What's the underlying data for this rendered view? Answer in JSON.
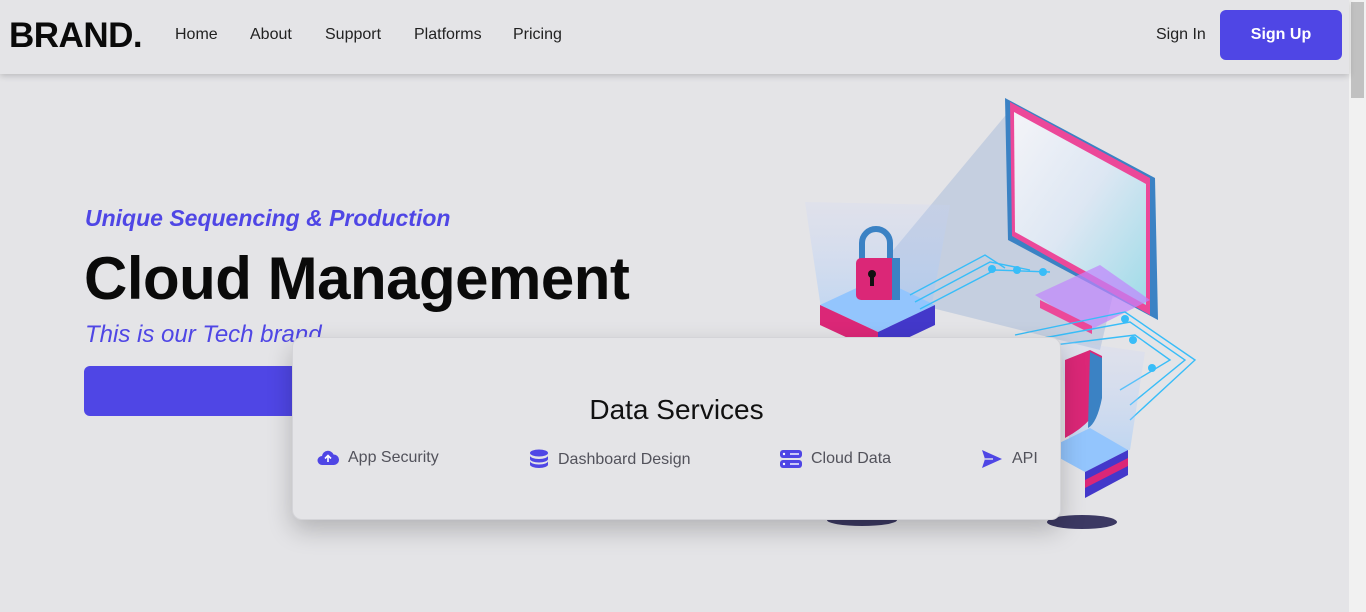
{
  "nav": {
    "brand": "BRAND.",
    "links": [
      "Home",
      "About",
      "Support",
      "Platforms",
      "Pricing"
    ],
    "sign_in": "Sign In",
    "sign_up": "Sign Up"
  },
  "hero": {
    "tagline": "Unique Sequencing & Production",
    "headline": "Cloud Management",
    "subtitle": "This is our Tech brand"
  },
  "services": {
    "title": "Data Services",
    "items": [
      {
        "label": "App Security",
        "icon": "cloud-upload-icon"
      },
      {
        "label": "Dashboard Design",
        "icon": "database-icon"
      },
      {
        "label": "Cloud Data",
        "icon": "server-icon"
      },
      {
        "label": "API",
        "icon": "paper-plane-icon"
      }
    ]
  },
  "colors": {
    "accent": "#4f46e5",
    "background": "#e4e4e7",
    "pink": "#db2777",
    "cyan": "#38bdf8"
  }
}
